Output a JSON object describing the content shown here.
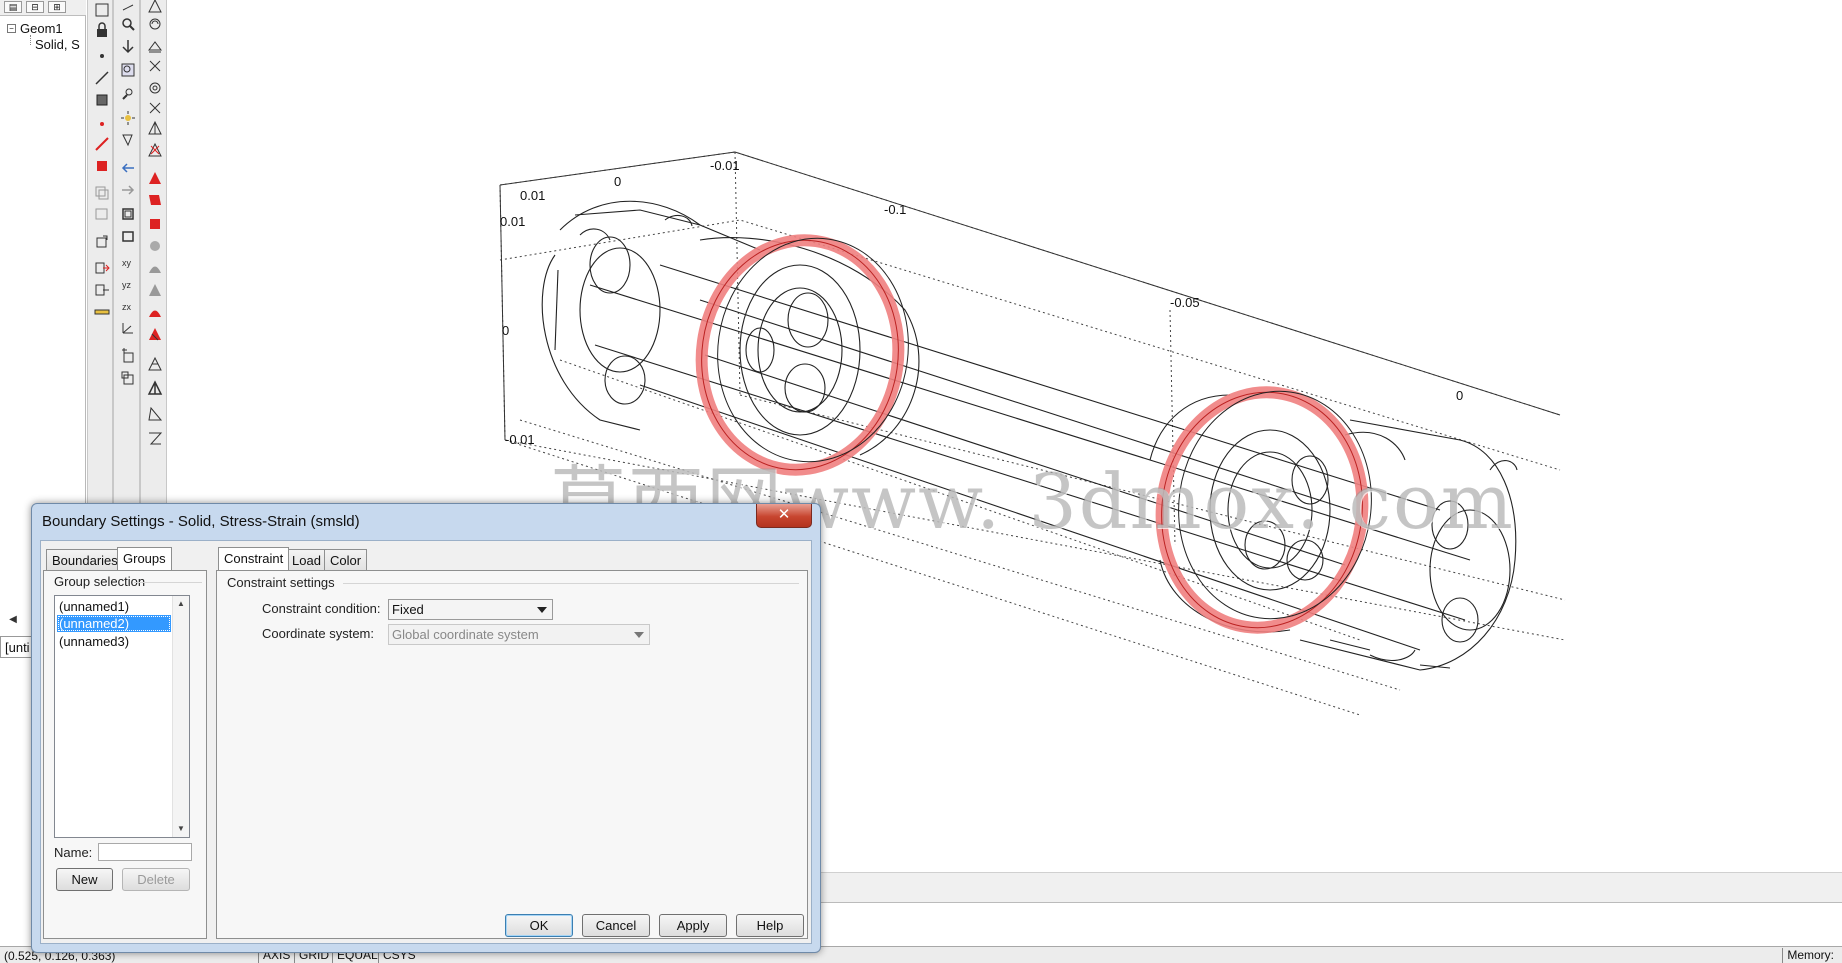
{
  "tree": {
    "root": "Geom1",
    "child": "Solid, S",
    "expander": "−",
    "bottom_clip": "[unti"
  },
  "view3d": {
    "axis_labels": [
      "0.01",
      "0",
      "-0.01",
      "-0.1",
      "0.01",
      "-0.05",
      "0",
      "0",
      "-0.01"
    ],
    "highlight_color": "#f08080"
  },
  "watermark": "莫西网www. 3dmox. com",
  "status": {
    "coords": "(0.525, 0.126, 0.363)",
    "toggles": [
      "AXIS",
      "GRID",
      "EQUAL",
      "CSYS"
    ],
    "memory": "Memory:"
  },
  "dialog": {
    "title": "Boundary Settings - Solid, Stress-Strain (smsld)",
    "close_label": "✕",
    "left_tabs": [
      "Boundaries",
      "Groups"
    ],
    "active_left_tab": "Groups",
    "group_selection_label": "Group selection",
    "groups": [
      "(unnamed1)",
      "(unnamed2)",
      "(unnamed3)"
    ],
    "selected_group": "(unnamed2)",
    "name_label": "Name:",
    "name_value": "",
    "new_label": "New",
    "delete_label": "Delete",
    "right_tabs": [
      "Constraint",
      "Load",
      "Color"
    ],
    "active_right_tab": "Constraint",
    "constraint_settings_label": "Constraint settings",
    "constraint_condition_label": "Constraint condition:",
    "constraint_condition_value": "Fixed",
    "coordinate_system_label": "Coordinate system:",
    "coordinate_system_value": "Global coordinate system",
    "ok_label": "OK",
    "cancel_label": "Cancel",
    "apply_label": "Apply",
    "help_label": "Help"
  }
}
